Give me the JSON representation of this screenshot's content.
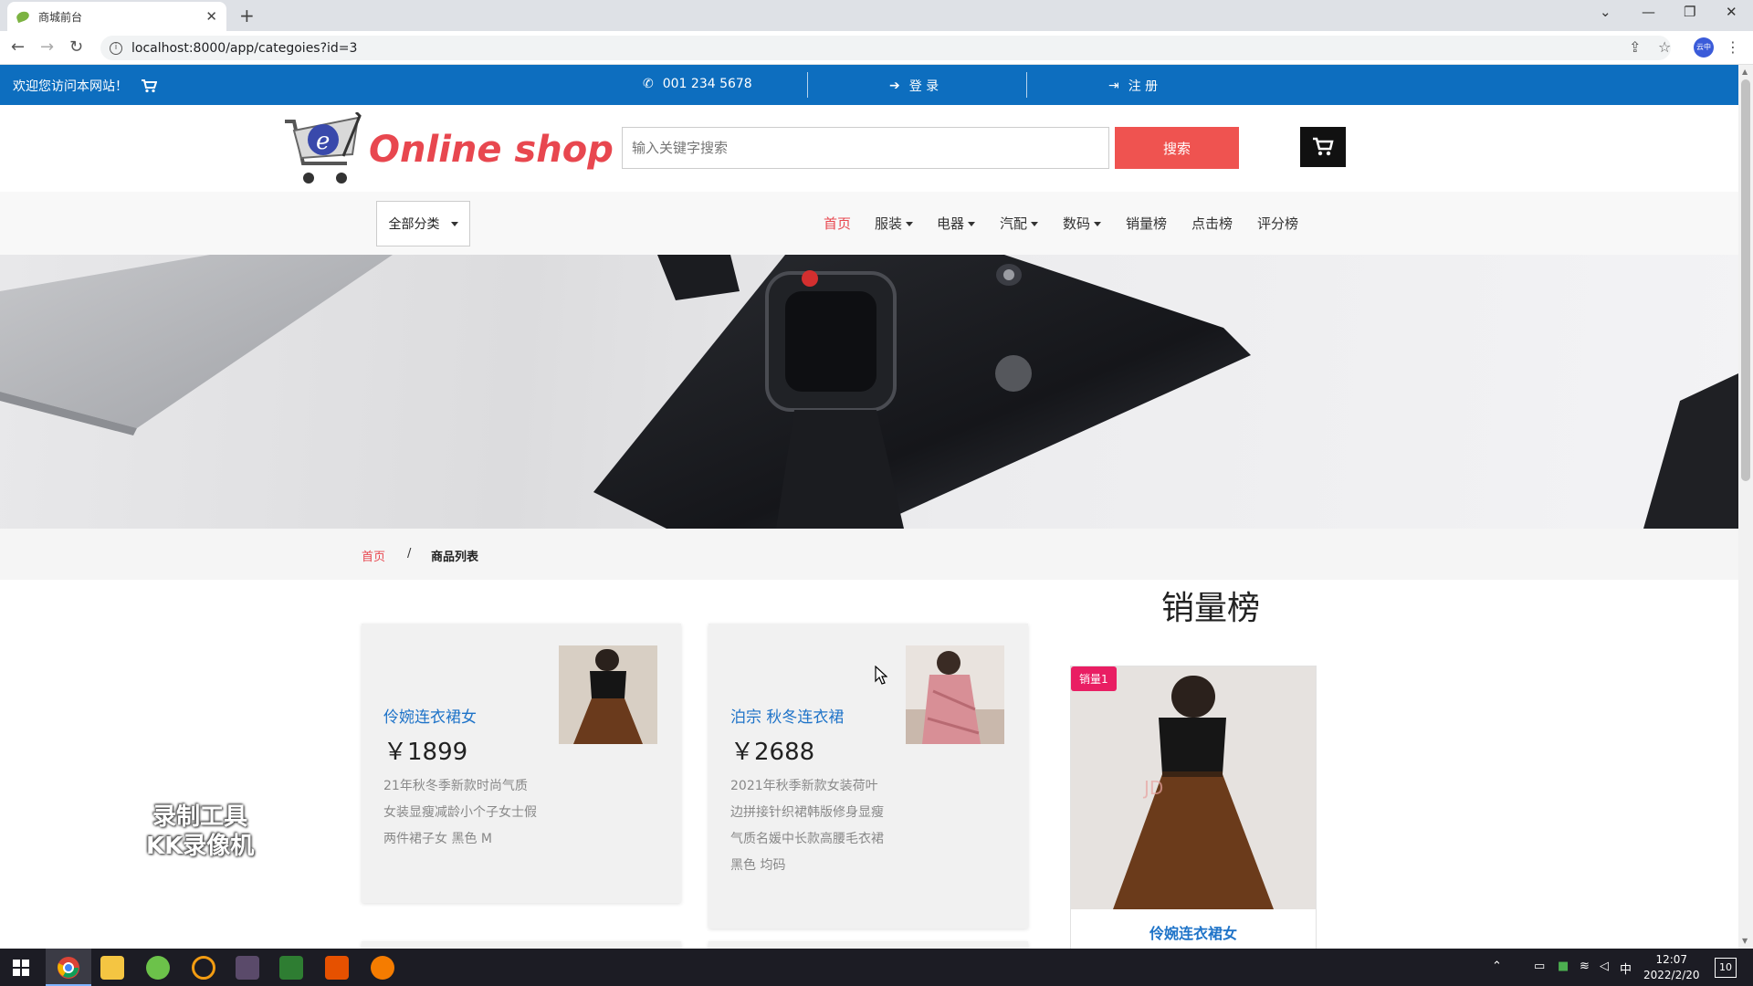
{
  "browser": {
    "tab_title": "商城前台",
    "url": "localhost:8000/app/categoies?id=3",
    "profile_label": "云中"
  },
  "topbar": {
    "welcome": "欢迎您访问本网站！",
    "phone": "001 234 5678",
    "login": "登 录",
    "register": "注 册"
  },
  "header": {
    "logo_text": "Online shop",
    "search_placeholder": "输入关键字搜索",
    "search_button": "搜索"
  },
  "navbar": {
    "category_select": "全部分类",
    "links": [
      {
        "label": "首页",
        "dropdown": false,
        "active": true
      },
      {
        "label": "服装",
        "dropdown": true,
        "active": false
      },
      {
        "label": "电器",
        "dropdown": true,
        "active": false
      },
      {
        "label": "汽配",
        "dropdown": true,
        "active": false
      },
      {
        "label": "数码",
        "dropdown": true,
        "active": false
      },
      {
        "label": "销量榜",
        "dropdown": false,
        "active": false
      },
      {
        "label": "点击榜",
        "dropdown": false,
        "active": false
      },
      {
        "label": "评分榜",
        "dropdown": false,
        "active": false
      }
    ]
  },
  "breadcrumb": {
    "home": "首页",
    "separator": "/",
    "current": "商品列表"
  },
  "products": [
    {
      "name": "伶婉连衣裙女",
      "price": "￥1899",
      "description": "21年秋冬季新款时尚气质女装显瘦减龄小个子女士假两件裙子女 黑色 M"
    },
    {
      "name": "泊宗 秋冬连衣裙",
      "price": "￥2688",
      "description": "2021年秋季新款女装荷叶边拼接针织裙韩版修身显瘦气质名媛中长款高腰毛衣裙 黑色 均码"
    }
  ],
  "ranking": {
    "title": "销量榜",
    "items": [
      {
        "badge": "销量1",
        "name": "伶婉连衣裙女"
      }
    ]
  },
  "watermark": {
    "line1": "录制工具",
    "line2": "KK录像机"
  },
  "taskbar": {
    "time": "12:07",
    "date": "2022/2/20",
    "ime": "中",
    "notification_count": "10"
  },
  "colors": {
    "topbar": "#0d6ebf",
    "accent_red": "#e8474f",
    "search_button": "#ef5350",
    "link_blue": "#1e73c8",
    "badge_pink": "#e91e63"
  }
}
